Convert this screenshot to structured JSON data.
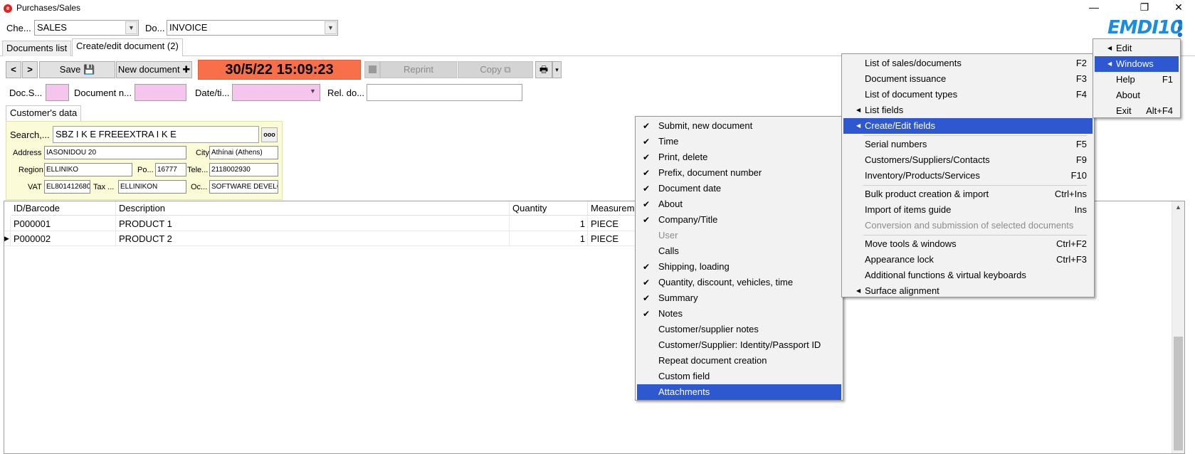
{
  "window": {
    "title": "Purchases/Sales",
    "app_icon_glyph": "e",
    "minimize": "—",
    "restore": "❐",
    "close": "✕"
  },
  "header": {
    "check_label": "Che...",
    "check_value": "SALES",
    "doc_label": "Do...",
    "doc_value": "INVOICE",
    "logo_text": "EMDI10",
    "kebab": "⋮"
  },
  "tabs": [
    {
      "label": "Documents list"
    },
    {
      "label": "Create/edit document (2)"
    }
  ],
  "toolbar": {
    "prev": "<",
    "next": ">",
    "save_label": "Save 💾",
    "new_label": "New document ✚",
    "datetime": "30/5/22 15:09:23",
    "reprint_label": "Reprint",
    "copy_label": "Copy ⧉",
    "print_icon": "🖶",
    "print_arrow": "▾"
  },
  "fields_row": {
    "doc_series_label": "Doc.S...",
    "doc_number_label": "Document n...",
    "date_label": "Date/ti...",
    "rel_doc_label": "Rel. do..."
  },
  "customer": {
    "tab_label": "Customer's data",
    "search_label": "Search,...",
    "search_value": "SBZ I K E  FREEEXTRA I K E",
    "more_button": "ooo",
    "address_label": "Address",
    "address_value": "IASONIDOU 20",
    "city_label": "City",
    "city_value": "Athínai (Athens)",
    "region_label": "Region",
    "region_value": "ELLINIKO",
    "postal_label": "Po...",
    "postal_value": "16777",
    "tel_label": "Tele...",
    "tel_value": "2118002930",
    "vat_label": "VAT",
    "vat_value": "EL801412680",
    "tax_label": "Tax ...",
    "tax_value": "ELLINIKON",
    "occ_label": "Oc...",
    "occ_value": "SOFTWARE DEVELOPMENT"
  },
  "grid": {
    "columns": [
      "ID/Barcode",
      "Description",
      "Quantity",
      "Measureme"
    ],
    "rows": [
      {
        "marker": "",
        "id": "P000001",
        "description": "PRODUCT 1",
        "quantity": "1",
        "unit": "PIECE"
      },
      {
        "marker": "▶",
        "id": "P000002",
        "description": "PRODUCT 2",
        "quantity": "1",
        "unit": "PIECE"
      }
    ],
    "scroll_up": "▲"
  },
  "main_menu": [
    {
      "label": "Edit",
      "submenu": true,
      "shortcut": ""
    },
    {
      "label": "Windows",
      "submenu": true,
      "shortcut": "",
      "highlighted": true
    },
    {
      "label": "Help",
      "submenu": false,
      "shortcut": "F1"
    },
    {
      "label": "About",
      "submenu": false,
      "shortcut": ""
    },
    {
      "label": "Exit",
      "submenu": false,
      "shortcut": "Alt+F4"
    }
  ],
  "windows_menu": [
    {
      "label": "List of sales/documents",
      "shortcut": "F2"
    },
    {
      "label": "Document issuance",
      "shortcut": "F3"
    },
    {
      "label": "List of document types",
      "shortcut": "F4"
    },
    {
      "label": "List fields",
      "shortcut": "",
      "submenu": true
    },
    {
      "label": "Create/Edit fields",
      "shortcut": "",
      "submenu": true,
      "highlighted": true
    },
    {
      "label": "Serial numbers",
      "shortcut": "F5"
    },
    {
      "label": "Customers/Suppliers/Contacts",
      "shortcut": "F9"
    },
    {
      "label": "Inventory/Products/Services",
      "shortcut": "F10"
    },
    {
      "label": "Bulk product creation & import",
      "shortcut": "Ctrl+Ins"
    },
    {
      "label": "Import of items guide",
      "shortcut": "Ins"
    },
    {
      "label": "Conversion and submission of selected documents",
      "shortcut": "",
      "disabled": true
    },
    {
      "label": "Move tools & windows",
      "shortcut": "Ctrl+F2"
    },
    {
      "label": "Appearance lock",
      "shortcut": "Ctrl+F3"
    },
    {
      "label": "Additional functions & virtual keyboards",
      "shortcut": ""
    },
    {
      "label": "Surface alignment",
      "shortcut": "",
      "submenu": true
    }
  ],
  "fields_menu": [
    {
      "label": "Submit, new document",
      "checked": true
    },
    {
      "label": "Time",
      "checked": true
    },
    {
      "label": "Print, delete",
      "checked": true
    },
    {
      "label": "Prefix, document number",
      "checked": true
    },
    {
      "label": "Document date",
      "checked": true
    },
    {
      "label": "About",
      "checked": true
    },
    {
      "label": "Company/Title",
      "checked": true
    },
    {
      "label": "User",
      "checked": false,
      "disabled": true
    },
    {
      "label": "Calls",
      "checked": false
    },
    {
      "label": "Shipping, loading",
      "checked": true
    },
    {
      "label": "Quantity, discount, vehicles, time",
      "checked": true
    },
    {
      "label": "Summary",
      "checked": true
    },
    {
      "label": "Notes",
      "checked": true
    },
    {
      "label": "Customer/supplier notes",
      "checked": false
    },
    {
      "label": "Customer/Supplier: Identity/Passport ID",
      "checked": false
    },
    {
      "label": "Repeat document creation",
      "checked": false
    },
    {
      "label": "Custom field",
      "checked": false
    },
    {
      "label": "Attachments",
      "checked": false,
      "highlighted": true
    }
  ],
  "glyphs": {
    "check": "✔",
    "submenu_arrow": "◀",
    "combo_arrow": "▼"
  },
  "colors": {
    "date_bg": "#f7704a",
    "highlight": "#2e58d0",
    "pink_field": "#f6c5ee",
    "customer_panel": "#fbfbd8",
    "logo": "#1a8de0"
  }
}
